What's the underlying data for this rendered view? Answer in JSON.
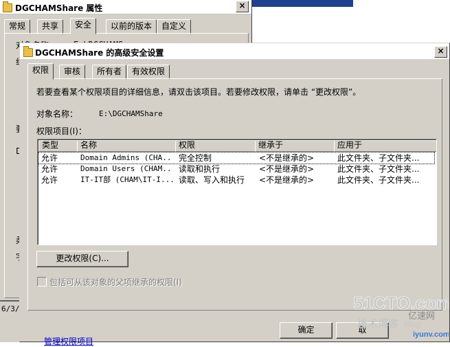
{
  "back_window": {
    "title": "DGCHAMShare 属性",
    "close": "×",
    "tabs": [
      {
        "label": "常规"
      },
      {
        "label": "共享"
      },
      {
        "label": "安全"
      },
      {
        "label": "以前的版本"
      },
      {
        "label": "自定义"
      }
    ],
    "object_label_fragment": "对象名称:",
    "object_value_fragment": "E:\\DGCHAMS",
    "fragments": [
      "组",
      "要",
      "D",
      "柔",
      "字"
    ]
  },
  "left_strip_text": "6/3/",
  "front_window": {
    "title": "DGCHAMShare 的高级安全设置",
    "close": "×",
    "tabs": [
      {
        "label": "权限"
      },
      {
        "label": "审核"
      },
      {
        "label": "所有者"
      },
      {
        "label": "有效权限"
      }
    ],
    "description": "若要查看某个权限项目的详细信息，请双击该项目。若要修改权限，请单击 “更改权限”。",
    "object_name_label": "对象名称：",
    "object_name_value": "E:\\DGCHAMShare",
    "entries_label": "权限项目(I)：",
    "columns": [
      "类型",
      "名称",
      "权限",
      "继承于",
      "应用于"
    ],
    "rows": [
      {
        "type": "允许",
        "name": "Domain Admins (CHA...",
        "permission": "完全控制",
        "inherited": "<不是继承的>",
        "applies": "此文件夹、子文件夹..."
      },
      {
        "type": "允许",
        "name": "Domain Users (CHAM...",
        "permission": "读取和执行",
        "inherited": "<不是继承的>",
        "applies": "此文件夹、子文件夹..."
      },
      {
        "type": "允许",
        "name": "IT-IT部 (CHAM\\IT-I...",
        "permission": "读取、写入和执行",
        "inherited": "<不是继承的>",
        "applies": "此文件夹、子文件夹..."
      }
    ],
    "change_permissions_button": "更改权限(C)...",
    "inherit_checkbox_label": "包括可从该对象的父项继承的权限(I)",
    "inherit_checked": false,
    "manage_link": "管理权限项目",
    "ok_button": "确定",
    "cancel_button_fragment": "取"
  },
  "watermark": {
    "line1": "51CTO.com",
    "line2": "技术博客",
    "line3": "Blog",
    "side_text": "亿速网",
    "url": "iyunv.com"
  }
}
